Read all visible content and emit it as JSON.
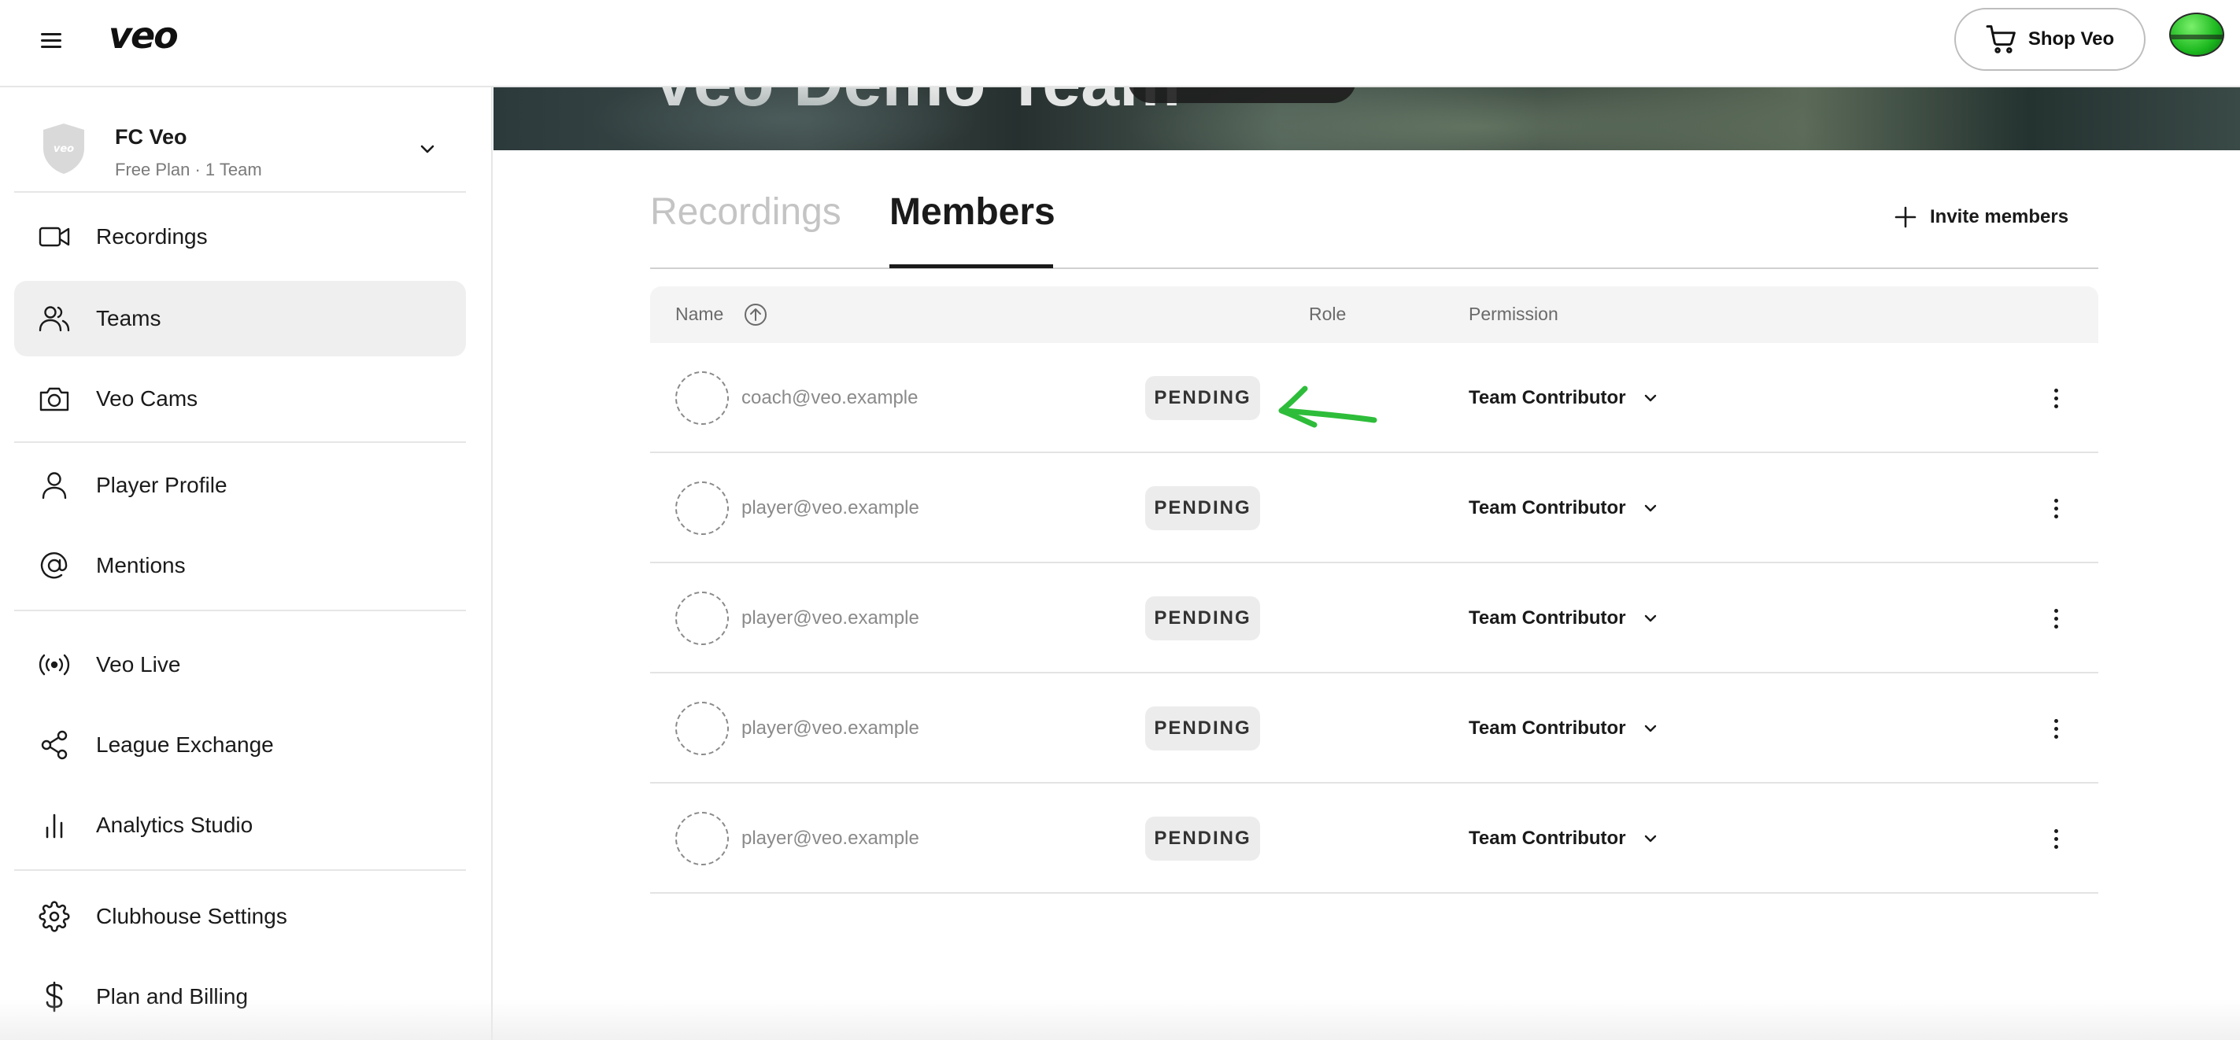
{
  "topbar": {
    "logo": "veo",
    "shop_label": "Shop Veo"
  },
  "sidebar": {
    "org": {
      "name": "FC Veo",
      "plan": "Free Plan · 1 Team"
    },
    "items": [
      {
        "label": "Recordings",
        "icon": "video-camera-icon"
      },
      {
        "label": "Teams",
        "icon": "users-icon",
        "active": true
      },
      {
        "label": "Veo Cams",
        "icon": "camera-icon"
      },
      {
        "label": "Player Profile",
        "icon": "user-icon"
      },
      {
        "label": "Mentions",
        "icon": "at-sign-icon"
      },
      {
        "label": "Veo Live",
        "icon": "broadcast-icon"
      },
      {
        "label": "League Exchange",
        "icon": "share-icon"
      },
      {
        "label": "Analytics Studio",
        "icon": "bar-chart-icon"
      },
      {
        "label": "Clubhouse Settings",
        "icon": "gear-icon"
      },
      {
        "label": "Plan and Billing",
        "icon": "dollar-icon"
      }
    ]
  },
  "hero": {
    "title": "Veo Demo Team"
  },
  "tabs": {
    "recordings": "Recordings",
    "members": "Members",
    "active": "Members"
  },
  "invite_label": "Invite members",
  "table": {
    "headers": {
      "name": "Name",
      "role": "Role",
      "permission": "Permission"
    },
    "rows": [
      {
        "email": "coach@veo.example",
        "status": "PENDING",
        "permission": "Team Contributor"
      },
      {
        "email": "player@veo.example",
        "status": "PENDING",
        "permission": "Team Contributor"
      },
      {
        "email": "player@veo.example",
        "status": "PENDING",
        "permission": "Team Contributor"
      },
      {
        "email": "player@veo.example",
        "status": "PENDING",
        "permission": "Team Contributor"
      },
      {
        "email": "player@veo.example",
        "status": "PENDING",
        "permission": "Team Contributor"
      }
    ]
  },
  "colors": {
    "annotation_arrow": "#2ebd3a",
    "active_nav_bg": "#efefef",
    "pending_bg": "#ececec"
  }
}
